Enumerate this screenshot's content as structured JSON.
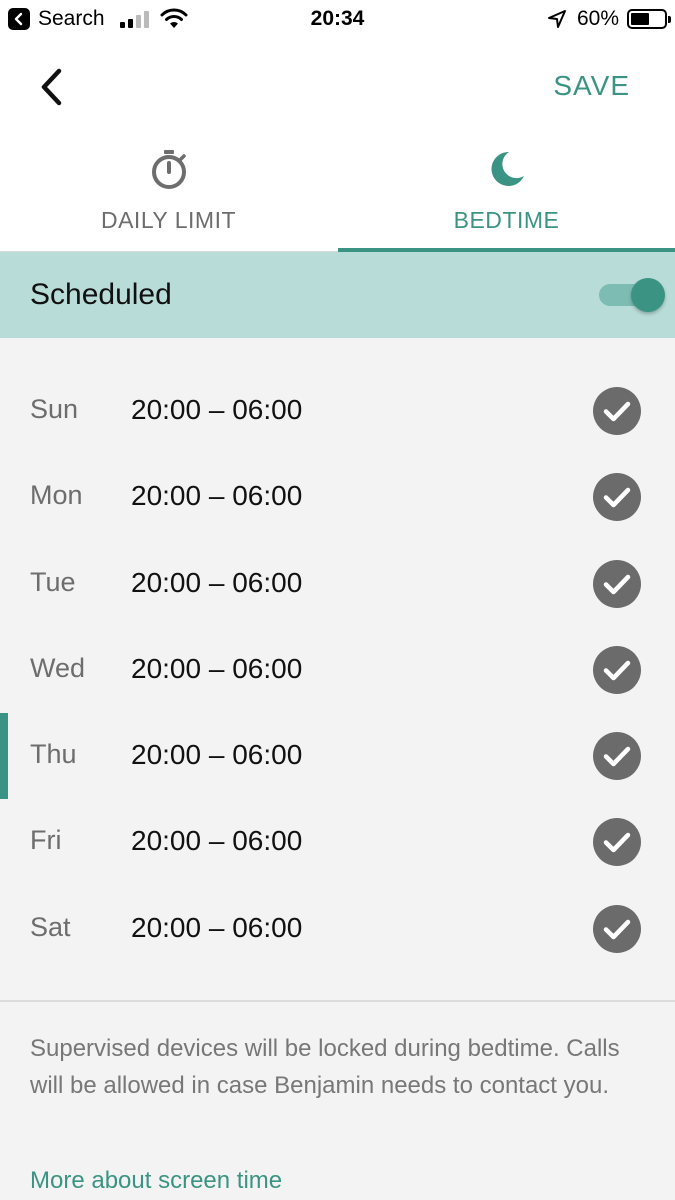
{
  "status_bar": {
    "back_app_label": "Search",
    "time": "20:34",
    "battery_percent": "60%",
    "battery_level": 0.6,
    "icons": [
      "back-app-icon",
      "cellular-signal-icon",
      "wifi-icon",
      "location-arrow-icon",
      "battery-icon"
    ]
  },
  "header": {
    "back_icon": "chevron-left-icon",
    "save_label": "SAVE"
  },
  "tabs": [
    {
      "label": "DAILY LIMIT",
      "icon": "stopwatch-icon",
      "active": false
    },
    {
      "label": "BEDTIME",
      "icon": "moon-icon",
      "active": true
    }
  ],
  "schedule": {
    "label": "Scheduled",
    "enabled": true
  },
  "days": [
    {
      "day": "Sun",
      "range": "20:00 – 06:00",
      "checked": true,
      "current": false
    },
    {
      "day": "Mon",
      "range": "20:00 – 06:00",
      "checked": true,
      "current": false
    },
    {
      "day": "Tue",
      "range": "20:00 – 06:00",
      "checked": true,
      "current": false
    },
    {
      "day": "Wed",
      "range": "20:00 – 06:00",
      "checked": true,
      "current": false
    },
    {
      "day": "Thu",
      "range": "20:00 – 06:00",
      "checked": true,
      "current": true
    },
    {
      "day": "Fri",
      "range": "20:00 – 06:00",
      "checked": true,
      "current": false
    },
    {
      "day": "Sat",
      "range": "20:00 – 06:00",
      "checked": true,
      "current": false
    }
  ],
  "footer": {
    "note": "Supervised devices will be locked during bedtime. Calls will be allowed in case Benjamin needs to contact you.",
    "link": "More about screen time"
  },
  "colors": {
    "accent": "#3b9483",
    "scheduled_bar": "#b8dcd8",
    "background": "#f3f3f3",
    "check_circle": "#6b6b6b"
  }
}
